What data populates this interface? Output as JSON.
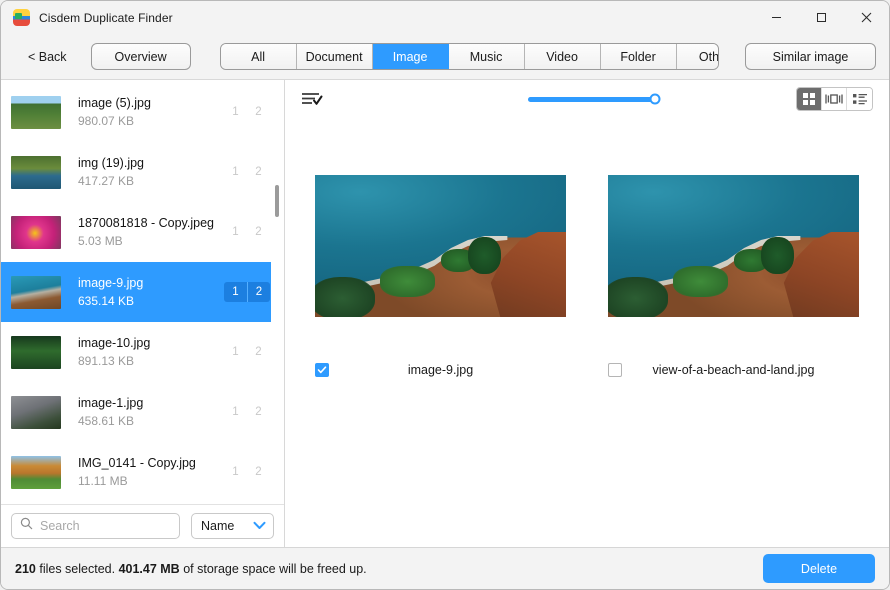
{
  "window": {
    "title": "Cisdem Duplicate Finder",
    "icon": "app-icon",
    "minimize": "─",
    "maximize": "□",
    "close": "✕"
  },
  "toolbar": {
    "back_label": "< Back",
    "overview_label": "Overview",
    "tabs": [
      {
        "label": "All",
        "active": false
      },
      {
        "label": "Document",
        "active": false
      },
      {
        "label": "Image",
        "active": true
      },
      {
        "label": "Music",
        "active": false
      },
      {
        "label": "Video",
        "active": false
      },
      {
        "label": "Folder",
        "active": false
      },
      {
        "label": "Other",
        "active": false
      }
    ],
    "similar_image_label": "Similar image",
    "active_tab": "Image",
    "accent_color": "#2e9bff"
  },
  "sidebar": {
    "files": [
      {
        "name": "image (5).jpg",
        "size": "980.07 KB",
        "badge1": "1",
        "badge2": "2",
        "selected": false
      },
      {
        "name": "img (19).jpg",
        "size": "417.27 KB",
        "badge1": "1",
        "badge2": "2",
        "selected": false
      },
      {
        "name": "1870081818 - Copy.jpeg",
        "size": "5.03 MB",
        "badge1": "1",
        "badge2": "2",
        "selected": false
      },
      {
        "name": "image-9.jpg",
        "size": "635.14 KB",
        "badge1": "1",
        "badge2": "2",
        "selected": true
      },
      {
        "name": "image-10.jpg",
        "size": "891.13 KB",
        "badge1": "1",
        "badge2": "2",
        "selected": false
      },
      {
        "name": "image-1.jpg",
        "size": "458.61 KB",
        "badge1": "1",
        "badge2": "2",
        "selected": false
      },
      {
        "name": "IMG_0141 - Copy.jpg",
        "size": "11.11 MB",
        "badge1": "1",
        "badge2": "2",
        "selected": false
      }
    ],
    "search": {
      "placeholder": "Search",
      "value": "",
      "icon": "search-icon"
    },
    "sort": {
      "selected": "Name",
      "icon": "chevron-down-icon"
    }
  },
  "content": {
    "select_all_icon": "list-check-icon",
    "zoom_slider": {
      "value": 96,
      "min": 0,
      "max": 100
    },
    "view_modes": [
      {
        "name": "grid-view",
        "icon": "grid-icon",
        "active": true
      },
      {
        "name": "coverflow-view",
        "icon": "coverflow-icon",
        "active": false
      },
      {
        "name": "list-view",
        "icon": "list-icon",
        "active": false
      }
    ],
    "cards": [
      {
        "name": "image-9.jpg",
        "checked": true
      },
      {
        "name": "view-of-a-beach-and-land.jpg",
        "checked": false
      }
    ]
  },
  "statusbar": {
    "count": "210",
    "count_suffix": "files selected.",
    "size": "401.47 MB",
    "size_suffix": "of storage space will be freed up.",
    "delete_label": "Delete"
  }
}
